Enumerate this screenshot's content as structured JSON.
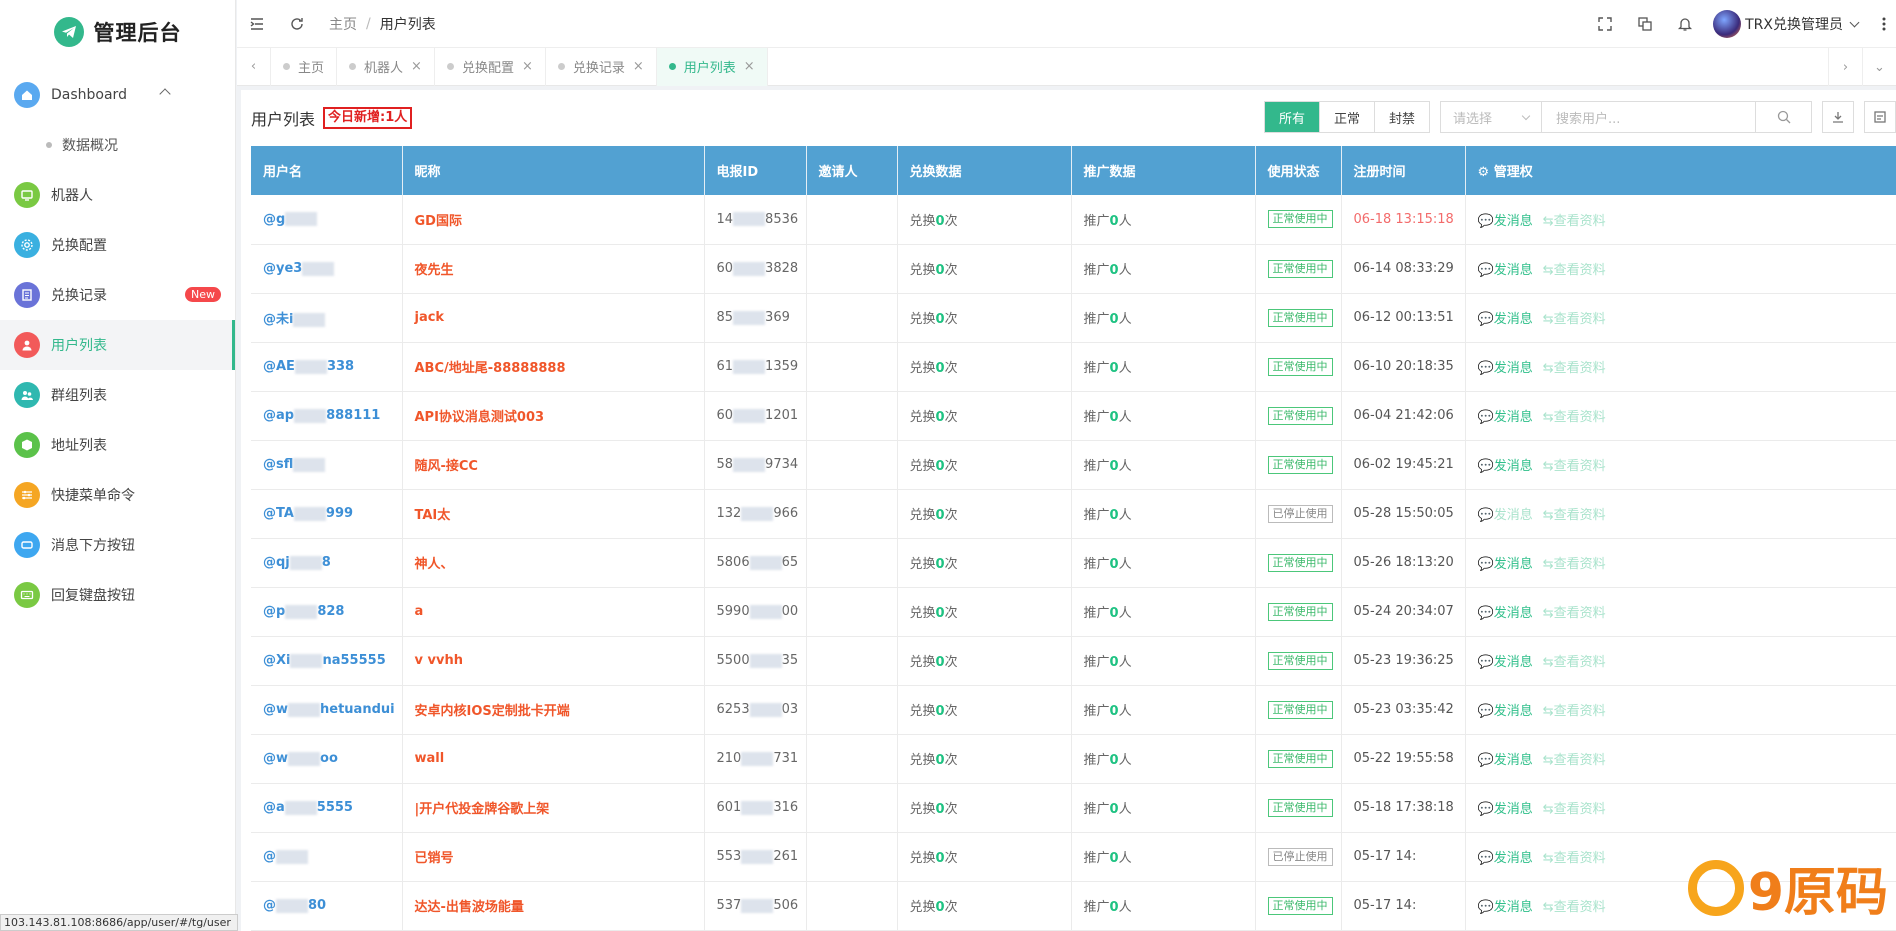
{
  "app": {
    "title": "管理后台"
  },
  "sidebar": {
    "items": [
      {
        "label": "Dashboard",
        "icon": "home-icon",
        "color": "#5aa9f0",
        "expanded": true,
        "children": [
          "数据概况"
        ]
      },
      {
        "label": "机器人",
        "icon": "monitor-icon",
        "color": "#7ac943"
      },
      {
        "label": "兑换配置",
        "icon": "settings-icon",
        "color": "#3ab0e0"
      },
      {
        "label": "兑换记录",
        "icon": "document-icon",
        "color": "#6a73d8",
        "badge": "New"
      },
      {
        "label": "用户列表",
        "icon": "user-icon",
        "color": "#f25a5a",
        "active": true
      },
      {
        "label": "群组列表",
        "icon": "group-icon",
        "color": "#2fb8b0"
      },
      {
        "label": "地址列表",
        "icon": "cube-icon",
        "color": "#5bc24a"
      },
      {
        "label": "快捷菜单命令",
        "icon": "sliders-icon",
        "color": "#f5a623"
      },
      {
        "label": "消息下方按钮",
        "icon": "button-icon",
        "color": "#3ea7f0"
      },
      {
        "label": "回复键盘按钮",
        "icon": "keyboard-icon",
        "color": "#7ac943"
      }
    ],
    "status_url": "103.143.81.108:8686/app/user/#/tg/user"
  },
  "header": {
    "breadcrumb": [
      "主页",
      "用户列表"
    ],
    "user_name": "TRX兑换管理员"
  },
  "tabs": [
    {
      "label": "主页",
      "closable": false
    },
    {
      "label": "机器人",
      "closable": true
    },
    {
      "label": "兑换配置",
      "closable": true
    },
    {
      "label": "兑换记录",
      "closable": true
    },
    {
      "label": "用户列表",
      "closable": true,
      "active": true
    }
  ],
  "page": {
    "title": "用户列表",
    "today_new": "今日新增:1人",
    "filters": [
      "所有",
      "正常",
      "封禁"
    ],
    "active_filter": "所有",
    "select_placeholder": "请选择",
    "search_placeholder": "搜索用户..."
  },
  "table": {
    "columns": [
      "用户名",
      "昵称",
      "电报ID",
      "邀请人",
      "兑换数据",
      "推广数据",
      "使用状态",
      "注册时间",
      "管理权"
    ],
    "manage_icon": "settings-icon",
    "action_send": "发消息",
    "action_view": "查看资料",
    "exchange_prefix": "兑换",
    "exchange_suffix": "次",
    "promo_prefix": "推广",
    "promo_suffix": "人",
    "rows": [
      {
        "username": "@g",
        "nickname": "GD国际",
        "tgid_a": "14",
        "tgid_b": "8536",
        "inviter": "",
        "exchange": "0",
        "promo": "0",
        "status": "正常使用中",
        "status_type": "ok",
        "time": "06-18 13:15:18",
        "time_red": true
      },
      {
        "username": "@ye3",
        "nickname": "夜先生",
        "tgid_a": "60",
        "tgid_b": "3828",
        "inviter": "",
        "exchange": "0",
        "promo": "0",
        "status": "正常使用中",
        "status_type": "ok",
        "time": "06-14 08:33:29"
      },
      {
        "username": "@未i",
        "nickname": "jack",
        "tgid_a": "85",
        "tgid_b": "369",
        "inviter": "",
        "exchange": "0",
        "promo": "0",
        "status": "正常使用中",
        "status_type": "ok",
        "time": "06-12 00:13:51"
      },
      {
        "username": "@AE",
        "username_b": "338",
        "nickname": "ABC/地址尾-88888888",
        "tgid_a": "61",
        "tgid_b": "1359",
        "inviter": "",
        "exchange": "0",
        "promo": "0",
        "status": "正常使用中",
        "status_type": "ok",
        "time": "06-10 20:18:35"
      },
      {
        "username": "@ap",
        "username_b": "888111",
        "nickname": "API协议消息测试003",
        "tgid_a": "60",
        "tgid_b": "1201",
        "inviter": "",
        "exchange": "0",
        "promo": "0",
        "status": "正常使用中",
        "status_type": "ok",
        "time": "06-04 21:42:06"
      },
      {
        "username": "@sfl",
        "nickname": "随风-接CC",
        "tgid_a": "58",
        "tgid_b": "9734",
        "inviter": "",
        "exchange": "0",
        "promo": "0",
        "status": "正常使用中",
        "status_type": "ok",
        "time": "06-02 19:45:21"
      },
      {
        "username": "@TA",
        "username_b": "999",
        "nickname": "TAI太",
        "tgid_a": "132",
        "tgid_b": "966",
        "inviter": "",
        "exchange": "0",
        "promo": "0",
        "status": "已停止使用",
        "status_type": "stop",
        "time": "05-28 15:50:05",
        "dim_send": true
      },
      {
        "username": "@qj",
        "username_b": "8",
        "nickname": "神人、",
        "tgid_a": "5806",
        "tgid_b": "65",
        "inviter": "",
        "exchange": "0",
        "promo": "0",
        "status": "正常使用中",
        "status_type": "ok",
        "time": "05-26 18:13:20"
      },
      {
        "username": "@p",
        "username_b": "828",
        "nickname": "a",
        "tgid_a": "5990",
        "tgid_b": "00",
        "inviter": "",
        "exchange": "0",
        "promo": "0",
        "status": "正常使用中",
        "status_type": "ok",
        "time": "05-24 20:34:07"
      },
      {
        "username": "@Xi",
        "username_b": "na55555",
        "nickname": "v vvhh",
        "tgid_a": "5500",
        "tgid_b": "35",
        "inviter": "",
        "exchange": "0",
        "promo": "0",
        "status": "正常使用中",
        "status_type": "ok",
        "time": "05-23 19:36:25"
      },
      {
        "username": "@w",
        "username_b": "hetuandui",
        "nickname": "安卓内核IOS定制批卡开端",
        "tgid_a": "6253",
        "tgid_b": "03",
        "inviter": "",
        "exchange": "0",
        "promo": "0",
        "status": "正常使用中",
        "status_type": "ok",
        "time": "05-23 03:35:42"
      },
      {
        "username": "@w",
        "username_b": "oo",
        "nickname": "wall",
        "tgid_a": "210",
        "tgid_b": "731",
        "inviter": "",
        "exchange": "0",
        "promo": "0",
        "status": "正常使用中",
        "status_type": "ok",
        "time": "05-22 19:55:58"
      },
      {
        "username": "@a",
        "username_b": "5555",
        "nickname": "|开户代投金牌谷歌上架",
        "tgid_a": "601",
        "tgid_b": "316",
        "inviter": "",
        "exchange": "0",
        "promo": "0",
        "status": "正常使用中",
        "status_type": "ok",
        "time": "05-18 17:38:18"
      },
      {
        "username": "@",
        "username_b": "",
        "nickname": "已销号",
        "tgid_a": "553",
        "tgid_b": "261",
        "inviter": "",
        "exchange": "0",
        "promo": "0",
        "status": "已停止使用",
        "status_type": "stop",
        "time": "05-17 14:",
        "dim_send": false
      },
      {
        "username": "@",
        "username_b": "80",
        "nickname": "达达-出售波场能量",
        "tgid_a": "537",
        "tgid_b": "506",
        "inviter": "",
        "exchange": "0",
        "promo": "0",
        "status": "正常使用中",
        "status_type": "ok",
        "time": "05-17 14:"
      }
    ]
  },
  "watermark": {
    "text": "9原码"
  }
}
